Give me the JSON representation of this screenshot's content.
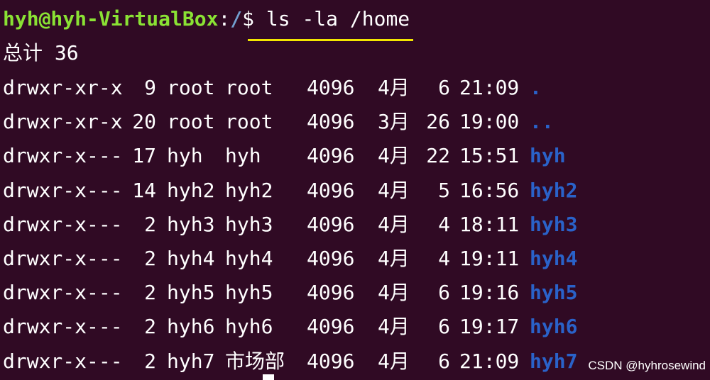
{
  "prompt": {
    "user_host": "hyh@hyh-VirtualBox",
    "separator": ":",
    "path": "/",
    "symbol": "$",
    "command": "ls -la /home"
  },
  "total_line": "总计 36",
  "entries": [
    {
      "perms": "drwxr-xr-x",
      "links": "9",
      "owner": "root",
      "group": "root",
      "size": "4096",
      "month": "4月",
      "day": "6",
      "time": "21:09",
      "name": "."
    },
    {
      "perms": "drwxr-xr-x",
      "links": "20",
      "owner": "root",
      "group": "root",
      "size": "4096",
      "month": "3月",
      "day": "26",
      "time": "19:00",
      "name": ".."
    },
    {
      "perms": "drwxr-x---",
      "links": "17",
      "owner": "hyh",
      "group": "hyh",
      "size": "4096",
      "month": "4月",
      "day": "22",
      "time": "15:51",
      "name": "hyh"
    },
    {
      "perms": "drwxr-x---",
      "links": "14",
      "owner": "hyh2",
      "group": "hyh2",
      "size": "4096",
      "month": "4月",
      "day": "5",
      "time": "16:56",
      "name": "hyh2"
    },
    {
      "perms": "drwxr-x---",
      "links": "2",
      "owner": "hyh3",
      "group": "hyh3",
      "size": "4096",
      "month": "4月",
      "day": "4",
      "time": "18:11",
      "name": "hyh3"
    },
    {
      "perms": "drwxr-x---",
      "links": "2",
      "owner": "hyh4",
      "group": "hyh4",
      "size": "4096",
      "month": "4月",
      "day": "4",
      "time": "19:11",
      "name": "hyh4"
    },
    {
      "perms": "drwxr-x---",
      "links": "2",
      "owner": "hyh5",
      "group": "hyh5",
      "size": "4096",
      "month": "4月",
      "day": "6",
      "time": "19:16",
      "name": "hyh5"
    },
    {
      "perms": "drwxr-x---",
      "links": "2",
      "owner": "hyh6",
      "group": "hyh6",
      "size": "4096",
      "month": "4月",
      "day": "6",
      "time": "19:17",
      "name": "hyh6"
    },
    {
      "perms": "drwxr-x---",
      "links": "2",
      "owner": "hyh7",
      "group": "市场部",
      "size": "4096",
      "month": "4月",
      "day": "6",
      "time": "21:09",
      "name": "hyh7"
    }
  ],
  "watermark": "CSDN @hyhrosewind",
  "colors": {
    "background": "#300a24",
    "prompt_user": "#8ae234",
    "prompt_path": "#729fcf",
    "directory": "#2a62c9",
    "underline": "#f2e600"
  }
}
